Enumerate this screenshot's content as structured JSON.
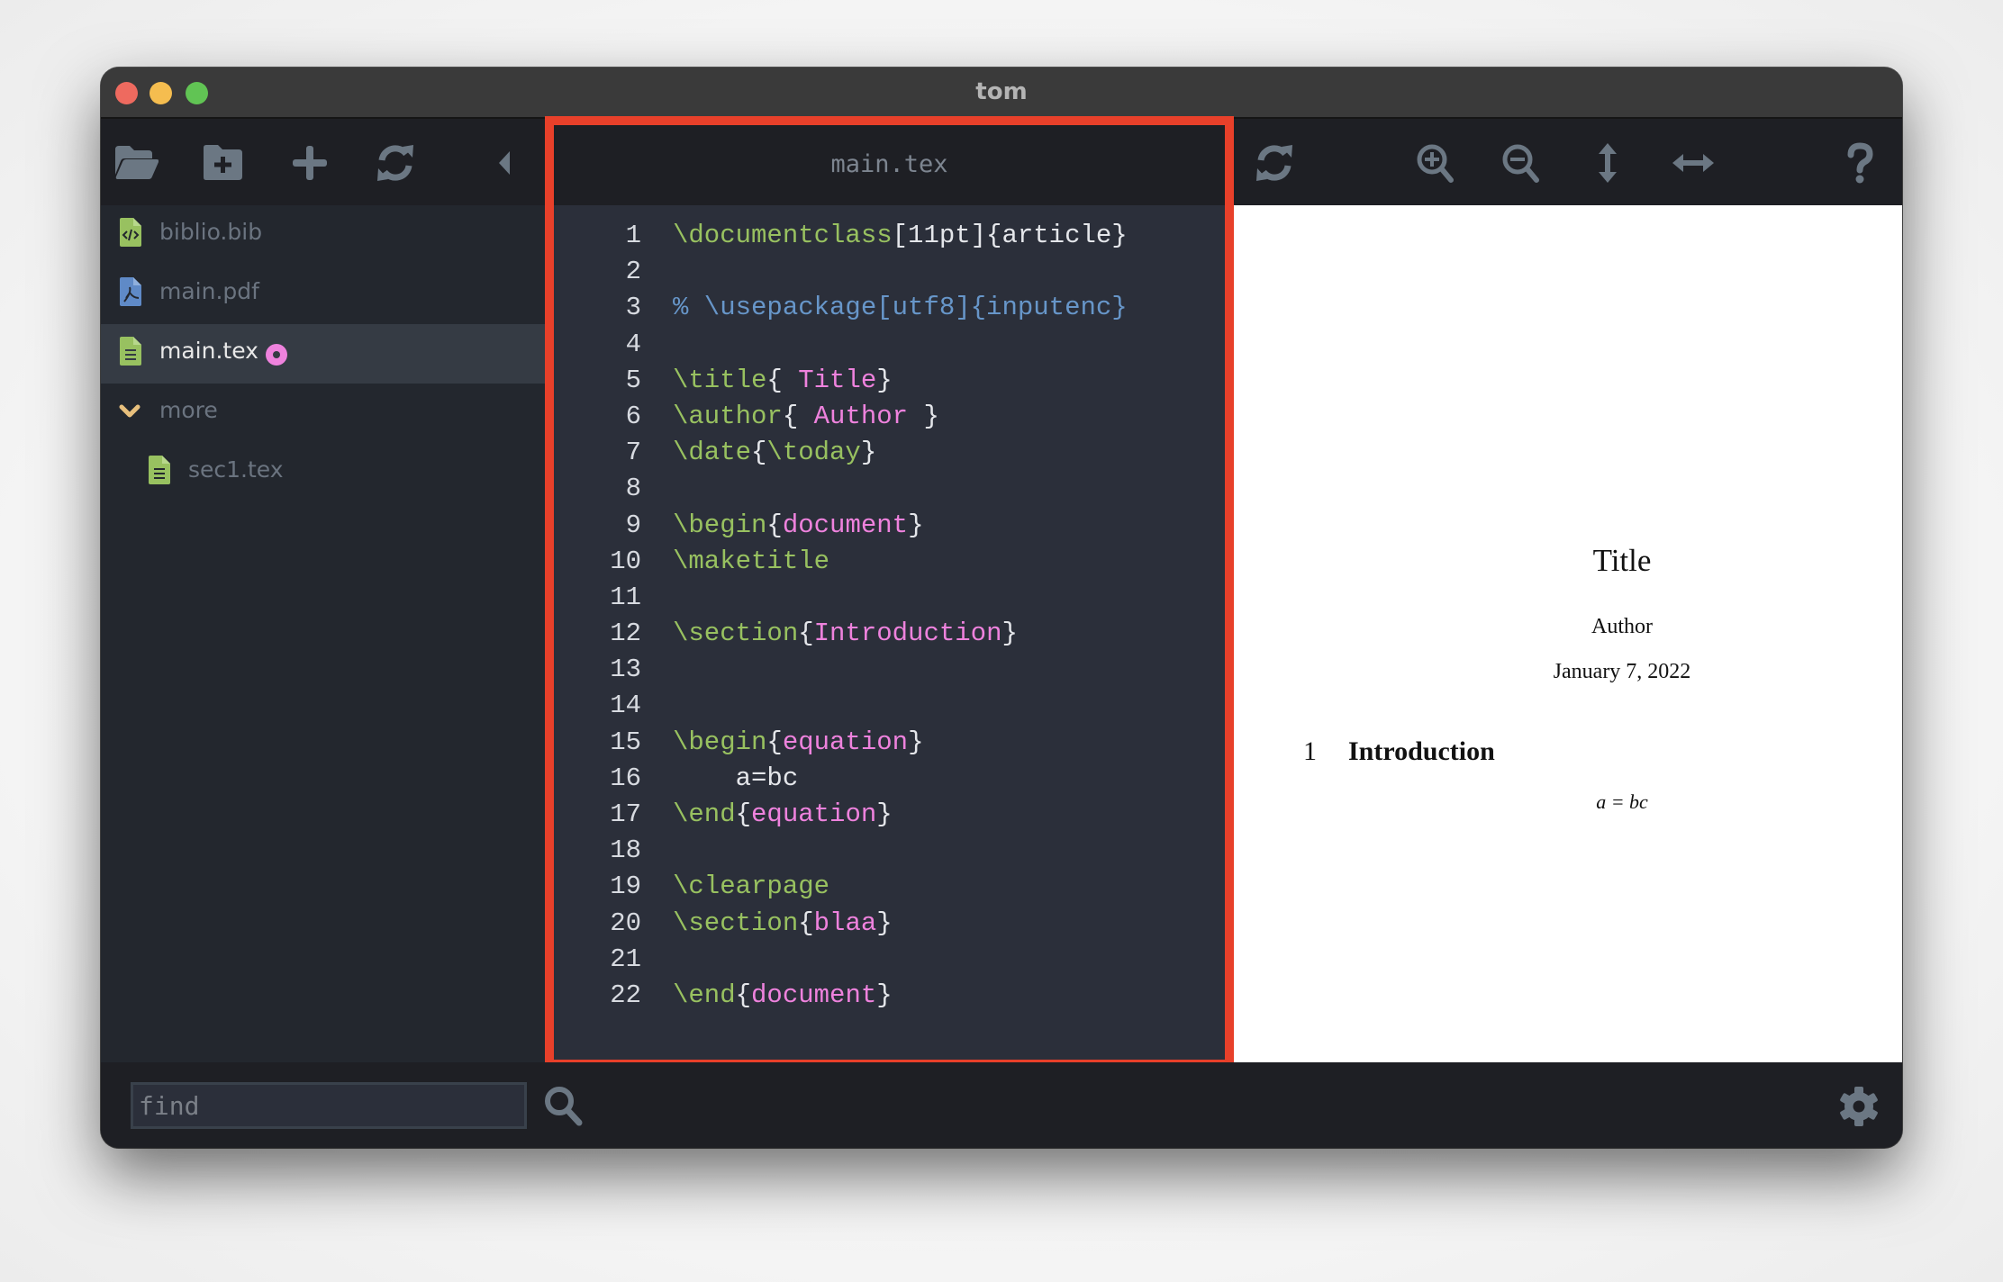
{
  "window": {
    "title": "tom",
    "traffic_lights": [
      "close",
      "minimize",
      "maximize"
    ]
  },
  "left_toolbar": {
    "buttons": [
      {
        "name": "open-folder",
        "icon": "folder-open-icon"
      },
      {
        "name": "new-folder",
        "icon": "folder-plus-icon"
      },
      {
        "name": "new-file",
        "icon": "plus-icon"
      },
      {
        "name": "refresh",
        "icon": "refresh-icon"
      },
      {
        "name": "collapse-sidebar",
        "icon": "caret-left-icon"
      }
    ]
  },
  "sidebar": {
    "items": [
      {
        "label": "biblio.bib",
        "icon": "file-code-icon",
        "icon_color": "#98c160",
        "active": false
      },
      {
        "label": "main.pdf",
        "icon": "file-pdf-icon",
        "icon_color": "#5f8ac7",
        "active": false
      },
      {
        "label": "main.tex",
        "icon": "file-text-icon",
        "icon_color": "#98c160",
        "active": true,
        "modified": true
      },
      {
        "label": "more",
        "icon": "chevron-down-icon",
        "icon_color": "#e8c07d",
        "type": "folder",
        "expanded": true
      },
      {
        "label": "sec1.tex",
        "icon": "file-text-icon",
        "icon_color": "#98c160",
        "active": false,
        "indent": 1
      }
    ]
  },
  "editor": {
    "filename": "main.tex",
    "highlight_color": "#e8402a",
    "lines": [
      {
        "n": "1",
        "tokens": [
          [
            "cmd",
            "\\documentclass"
          ],
          [
            "br",
            "[11pt]{article}"
          ]
        ]
      },
      {
        "n": "2",
        "tokens": []
      },
      {
        "n": "3",
        "tokens": [
          [
            "cmt",
            "% \\usepackage[utf8]{inputenc}"
          ]
        ]
      },
      {
        "n": "4",
        "tokens": []
      },
      {
        "n": "5",
        "tokens": [
          [
            "cmd",
            "\\title"
          ],
          [
            "br",
            "{ "
          ],
          [
            "arg",
            "Title"
          ],
          [
            "br",
            "}"
          ]
        ]
      },
      {
        "n": "6",
        "tokens": [
          [
            "cmd",
            "\\author"
          ],
          [
            "br",
            "{ "
          ],
          [
            "arg",
            "Author"
          ],
          [
            "br",
            " }"
          ]
        ]
      },
      {
        "n": "7",
        "tokens": [
          [
            "cmd",
            "\\date"
          ],
          [
            "br",
            "{"
          ],
          [
            "cmd",
            "\\today"
          ],
          [
            "br",
            "}"
          ]
        ]
      },
      {
        "n": "8",
        "tokens": []
      },
      {
        "n": "9",
        "tokens": [
          [
            "cmd",
            "\\begin"
          ],
          [
            "br",
            "{"
          ],
          [
            "arg",
            "document"
          ],
          [
            "br",
            "}"
          ]
        ]
      },
      {
        "n": "10",
        "tokens": [
          [
            "cmd",
            "\\maketitle"
          ]
        ]
      },
      {
        "n": "11",
        "tokens": []
      },
      {
        "n": "12",
        "tokens": [
          [
            "cmd",
            "\\section"
          ],
          [
            "br",
            "{"
          ],
          [
            "arg",
            "Introduction"
          ],
          [
            "br",
            "}"
          ]
        ]
      },
      {
        "n": "13",
        "tokens": []
      },
      {
        "n": "14",
        "tokens": []
      },
      {
        "n": "15",
        "tokens": [
          [
            "cmd",
            "\\begin"
          ],
          [
            "br",
            "{"
          ],
          [
            "arg",
            "equation"
          ],
          [
            "br",
            "}"
          ]
        ]
      },
      {
        "n": "16",
        "tokens": [
          [
            "br",
            "    a=bc"
          ]
        ]
      },
      {
        "n": "17",
        "tokens": [
          [
            "cmd",
            "\\end"
          ],
          [
            "br",
            "{"
          ],
          [
            "arg",
            "equation"
          ],
          [
            "br",
            "}"
          ]
        ]
      },
      {
        "n": "18",
        "tokens": []
      },
      {
        "n": "19",
        "tokens": [
          [
            "cmd",
            "\\clearpage"
          ]
        ]
      },
      {
        "n": "20",
        "tokens": [
          [
            "cmd",
            "\\section"
          ],
          [
            "br",
            "{"
          ],
          [
            "arg",
            "blaa"
          ],
          [
            "br",
            "}"
          ]
        ]
      },
      {
        "n": "21",
        "tokens": []
      },
      {
        "n": "22",
        "tokens": [
          [
            "cmd",
            "\\end"
          ],
          [
            "br",
            "{"
          ],
          [
            "arg",
            "document"
          ],
          [
            "br",
            "}"
          ]
        ]
      }
    ]
  },
  "right_toolbar": {
    "buttons": [
      {
        "name": "recompile",
        "icon": "refresh-icon"
      },
      {
        "name": "zoom-in",
        "icon": "zoom-in-icon"
      },
      {
        "name": "zoom-out",
        "icon": "zoom-out-icon"
      },
      {
        "name": "fit-height",
        "icon": "arrows-vertical-icon"
      },
      {
        "name": "fit-width",
        "icon": "arrows-horizontal-icon"
      },
      {
        "name": "help",
        "icon": "question-icon"
      }
    ]
  },
  "pdf": {
    "title": "Title",
    "author": "Author",
    "date": "January 7, 2022",
    "section_number": "1",
    "section_title": "Introduction",
    "equation": "a = bc"
  },
  "bottom_bar": {
    "find_placeholder": "find",
    "find_value": "",
    "search_icon": "search-icon",
    "settings_icon": "gear-icon"
  },
  "colors": {
    "command": "#98c160",
    "argument": "#ee82dd",
    "comment": "#6796c9",
    "modified_dot": "#ee82dd",
    "accent_box": "#e8402a"
  }
}
